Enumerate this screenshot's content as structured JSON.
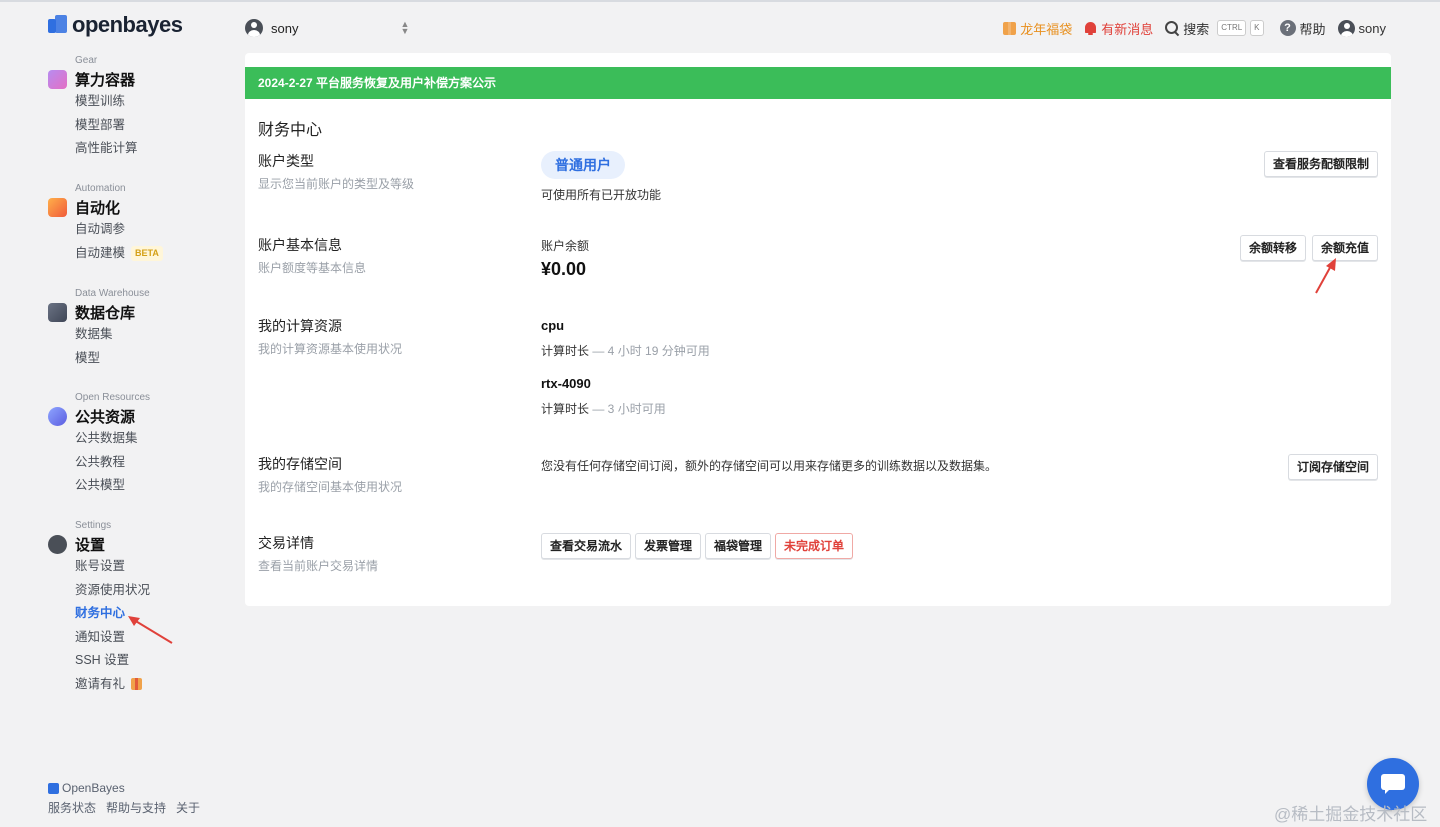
{
  "brand": {
    "logo_text": "openbayes",
    "accent": "#2f6fe0"
  },
  "sidebar": {
    "sections": [
      {
        "kicker": "Gear",
        "title": "算力容器",
        "items": [
          "模型训练",
          "模型部署",
          "高性能计算"
        ]
      },
      {
        "kicker": "Automation",
        "title": "自动化",
        "items": [
          "自动调参",
          "自动建模"
        ],
        "badge": "BETA"
      },
      {
        "kicker": "Data Warehouse",
        "title": "数据仓库",
        "items": [
          "数据集",
          "模型"
        ]
      },
      {
        "kicker": "Open Resources",
        "title": "公共资源",
        "items": [
          "公共数据集",
          "公共教程",
          "公共模型"
        ]
      },
      {
        "kicker": "Settings",
        "title": "设置",
        "items": [
          "账号设置",
          "资源使用状况",
          "财务中心",
          "通知设置",
          "SSH 设置",
          "邀请有礼"
        ],
        "active": "财务中心"
      }
    ],
    "footer": {
      "brand": "OpenBayes",
      "links": [
        "服务状态",
        "帮助与支持",
        "关于"
      ]
    }
  },
  "header": {
    "org_name": "sony",
    "promo": "龙年福袋",
    "notifications": "有新消息",
    "search": "搜索",
    "kbd": [
      "CTRL",
      "K"
    ],
    "help": "帮助",
    "user": "sony"
  },
  "main": {
    "banner": "2024-2-27 平台服务恢复及用户补偿方案公示",
    "banner_color": "#3bbd59",
    "title": "财务中心",
    "account_type": {
      "label": "账户类型",
      "desc": "显示您当前账户的类型及等级",
      "value": "普通用户",
      "note": "可使用所有已开放功能",
      "button": "查看服务配额限制"
    },
    "basic_info": {
      "label": "账户基本信息",
      "desc": "账户额度等基本信息",
      "balance_label": "账户余额",
      "balance": "¥0.00",
      "transfer_button": "余额转移",
      "recharge_button": "余额充值"
    },
    "compute": {
      "label": "我的计算资源",
      "desc": "我的计算资源基本使用状况",
      "resources": [
        {
          "name": "cpu",
          "prefix": "计算时长",
          "detail": " — 4 小时 19 分钟可用"
        },
        {
          "name": "rtx-4090",
          "prefix": "计算时长",
          "detail": " — 3 小时可用"
        }
      ]
    },
    "storage": {
      "label": "我的存储空间",
      "desc": "我的存储空间基本使用状况",
      "note": "您没有任何存储空间订阅，额外的存储空间可以用来存储更多的训练数据以及数据集。",
      "button": "订阅存储空间"
    },
    "transactions": {
      "label": "交易详情",
      "desc": "查看当前账户交易详情",
      "buttons": [
        "查看交易流水",
        "发票管理",
        "福袋管理",
        "未完成订单"
      ]
    }
  },
  "watermark": "@稀土掘金技术社区"
}
